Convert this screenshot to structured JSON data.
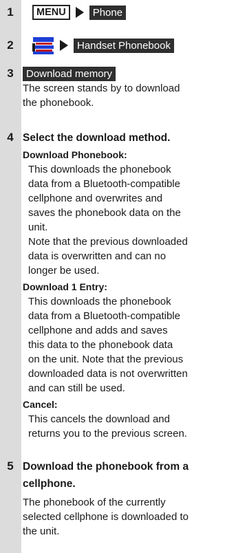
{
  "steps": [
    {
      "num": "1",
      "key": "MENU",
      "target": "Phone"
    },
    {
      "num": "2",
      "icon": "phonebook-icon",
      "target": "Handset Phonebook"
    },
    {
      "num": "3",
      "label": "Download memory",
      "desc": [
        "The screen stands by to download",
        "the phonebook."
      ]
    },
    {
      "num": "4",
      "heading": "Select the download method.",
      "options": [
        {
          "title": "Download Phonebook:",
          "lines": [
            "This downloads the phonebook",
            "data from a Bluetooth-compatible",
            "cellphone and overwrites and",
            "saves the phonebook data on the",
            "unit.",
            "Note that the previous downloaded",
            "data is overwritten and can no",
            "longer be used."
          ]
        },
        {
          "title": "Download 1 Entry:",
          "lines": [
            "This downloads the phonebook",
            "data from a Bluetooth-compatible",
            "cellphone and adds and saves",
            "this data to the phonebook data",
            "on the unit. Note that the previous",
            "downloaded data is not overwritten",
            "and can still be used."
          ]
        },
        {
          "title": "Cancel:",
          "lines": [
            "This cancels the download and",
            "returns you to the previous screen."
          ]
        }
      ]
    },
    {
      "num": "5",
      "heading_lines": [
        "Download the phonebook from a",
        "cellphone."
      ],
      "desc": [
        "The phonebook of the currently",
        "selected cellphone is downloaded to",
        "the unit."
      ]
    }
  ],
  "colors": {
    "sidebar": "#dcdcdc",
    "label_bg": "#2f2f2f",
    "icon_blue": "#1e3fd6",
    "icon_red": "#c0181e"
  }
}
